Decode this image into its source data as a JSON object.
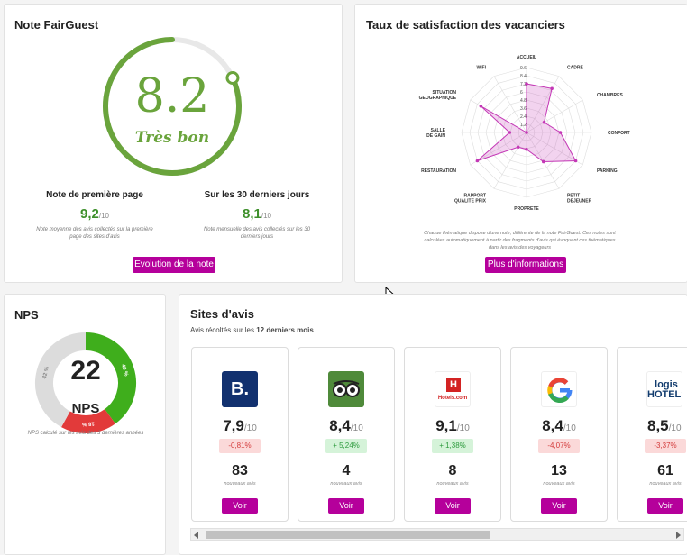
{
  "note": {
    "title": "Note FairGuest",
    "score": "8.2",
    "score_value": 8.2,
    "score_max": 10,
    "label": "Très bon",
    "first_page": {
      "title": "Note de première page",
      "value": "9,2",
      "den": "/10",
      "desc": "Note moyenne des avis collectés sur la première page des sites d'avis"
    },
    "last30": {
      "title": "Sur les 30 derniers jours",
      "value": "8,1",
      "den": "/10",
      "desc": "Note mensuelle des avis collectés sur les 30 derniers jours"
    },
    "button": "Evolution de la note",
    "colors": {
      "accent": "#6aa43c",
      "track": "#e5e5e5"
    }
  },
  "satisfaction": {
    "title": "Taux de satisfaction des vacanciers",
    "note": "Chaque thématique dispose d'une note, différente de la note FairGuest. Ces notes sont calculées automatiquement à partir des fragments d'avis qui évoquent ces thématiques dans les avis des voyageurs",
    "button": "Plus d'informations"
  },
  "chart_data": {
    "type": "radar",
    "categories": [
      "ACCUEIL",
      "CADRE",
      "CHAMBRES",
      "CONFORT",
      "PARKING",
      "PETIT DEJEUNER",
      "PROPRETE",
      "RAPPORT QUALITE PRIX",
      "RESTAURATION",
      "SALLE DE GAIN",
      "SITUATION GEOGRAPHIQUE",
      "WIFI"
    ],
    "values": [
      7.2,
      7.5,
      3.0,
      5.0,
      8.4,
      5.0,
      2.5,
      2.5,
      8.4,
      2.5,
      7.8,
      0.0
    ],
    "ticks": [
      "1.2",
      "2.4",
      "3.6",
      "4.8",
      "6",
      "7.2",
      "8.4",
      "9.6"
    ],
    "ylim": [
      0,
      9.6
    ],
    "color": "#c437b6"
  },
  "nps": {
    "title": "NPS",
    "value": "22",
    "label": "NPS",
    "segments": [
      {
        "label": "40 %",
        "value": 40,
        "color": "#3fae1c"
      },
      {
        "label": "18 %",
        "value": 18,
        "color": "#e23a3a"
      },
      {
        "label": "42 %",
        "value": 42,
        "color": "#dcdcdc"
      }
    ],
    "desc": "NPS calculé sur les avis des 3 dernières années"
  },
  "sites": {
    "title": "Sites d'avis",
    "subtitle_prefix": "Avis récoltés sur les ",
    "subtitle_bold": "12 derniers mois",
    "count_label": "nouveaux avis",
    "button": "Voir",
    "items": [
      {
        "name": "booking",
        "logo_text": "B.",
        "score": "7,9",
        "den": "/10",
        "delta": "-0,81%",
        "positive": false,
        "count": "83"
      },
      {
        "name": "tripadvisor",
        "logo_text": "oo",
        "score": "8,4",
        "den": "/10",
        "delta": "+ 5,24%",
        "positive": true,
        "count": "4"
      },
      {
        "name": "hotels.com",
        "logo_text": "Hotels.com",
        "score": "9,1",
        "den": "/10",
        "delta": "+ 1,38%",
        "positive": true,
        "count": "8"
      },
      {
        "name": "google",
        "logo_text": "G",
        "score": "8,4",
        "den": "/10",
        "delta": "-4,07%",
        "positive": false,
        "count": "13"
      },
      {
        "name": "logis",
        "logo_text": "logis HOTELS",
        "score": "8,5",
        "den": "/10",
        "delta": "-3,37%",
        "positive": false,
        "count": "61"
      }
    ]
  }
}
